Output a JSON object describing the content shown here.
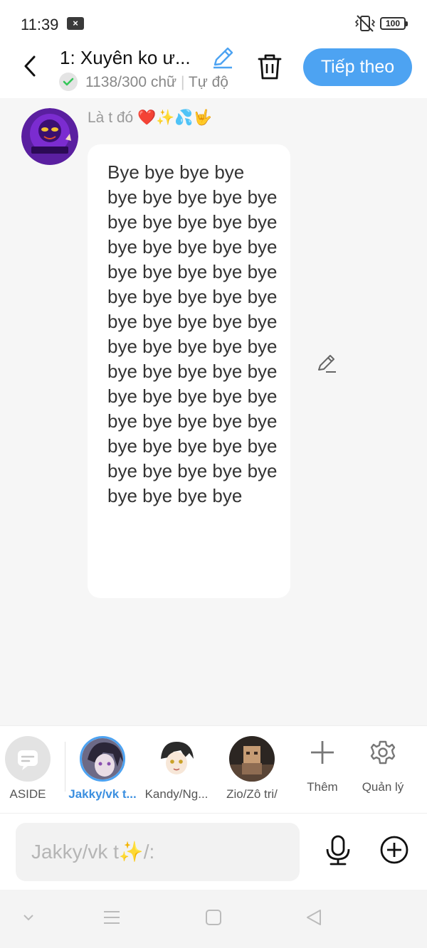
{
  "status": {
    "time": "11:39",
    "notif_glyph": "×",
    "battery": "100"
  },
  "header": {
    "title": "1: Xuyên ko ư...",
    "word_count": "1138/300 chữ",
    "mode": "Tự độ",
    "next_label": "Tiếp theo"
  },
  "message": {
    "character_name": "Là t đó ❤️✨💦🤟",
    "text": "Bye bye bye bye bye bye bye bye bye bye bye bye bye bye bye bye bye bye bye bye bye bye bye bye bye bye bye bye bye bye bye bye bye bye bye bye bye bye bye bye bye bye bye bye bye bye bye bye bye bye bye bye bye bye bye bye bye bye bye bye bye bye bye bye bye bye bye bye"
  },
  "characters": [
    {
      "label": "ASIDE"
    },
    {
      "label": "Jakky/vk t..."
    },
    {
      "label": "Kandy/Ng..."
    },
    {
      "label": "Zio/Zô tri/"
    },
    {
      "label": "Thêm"
    },
    {
      "label": "Quản lý"
    }
  ],
  "input": {
    "placeholder": "Jakky/vk t✨/:"
  },
  "colors": {
    "accent": "#4da3f2",
    "active_label": "#3b8fe0",
    "check_green": "#34c759"
  },
  "icons": [
    "back-arrow-icon",
    "pencil-icon",
    "trash-icon",
    "check-icon",
    "microphone-icon",
    "plus-circle-icon",
    "gear-icon",
    "plus-icon",
    "chat-icon"
  ]
}
